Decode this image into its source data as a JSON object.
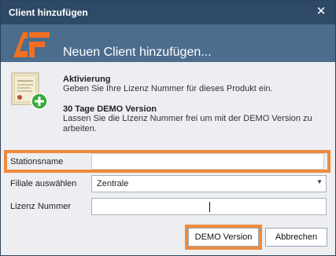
{
  "window": {
    "title": "Client hinzufügen",
    "close_glyph": "✕"
  },
  "banner": {
    "heading": "Neuen Client hinzufügen...",
    "logo": "AF"
  },
  "info": [
    {
      "heading": "Aktivierung",
      "text": "Geben Sie Ihre Lizenz Nummer für dieses Produkt ein."
    },
    {
      "heading": "30 Tage DEMO Version",
      "text": "Lassen Sie die LIzenz Nummer frei um mit der DEMO Version zu arbeiten."
    }
  ],
  "form": {
    "station": {
      "label": "Stationsname",
      "value": ""
    },
    "filiale": {
      "label": "Filiale auswählen",
      "value": "Zentrale"
    },
    "lizenz": {
      "label": "Lizenz Nummer",
      "value": ""
    }
  },
  "buttons": {
    "demo": "DEMO Version",
    "cancel": "Abbrechen"
  },
  "colors": {
    "titlebar": "#2f4a66",
    "banner": "#4d6d8e",
    "highlight": "#f08a3c",
    "logo": "#f26f21"
  }
}
